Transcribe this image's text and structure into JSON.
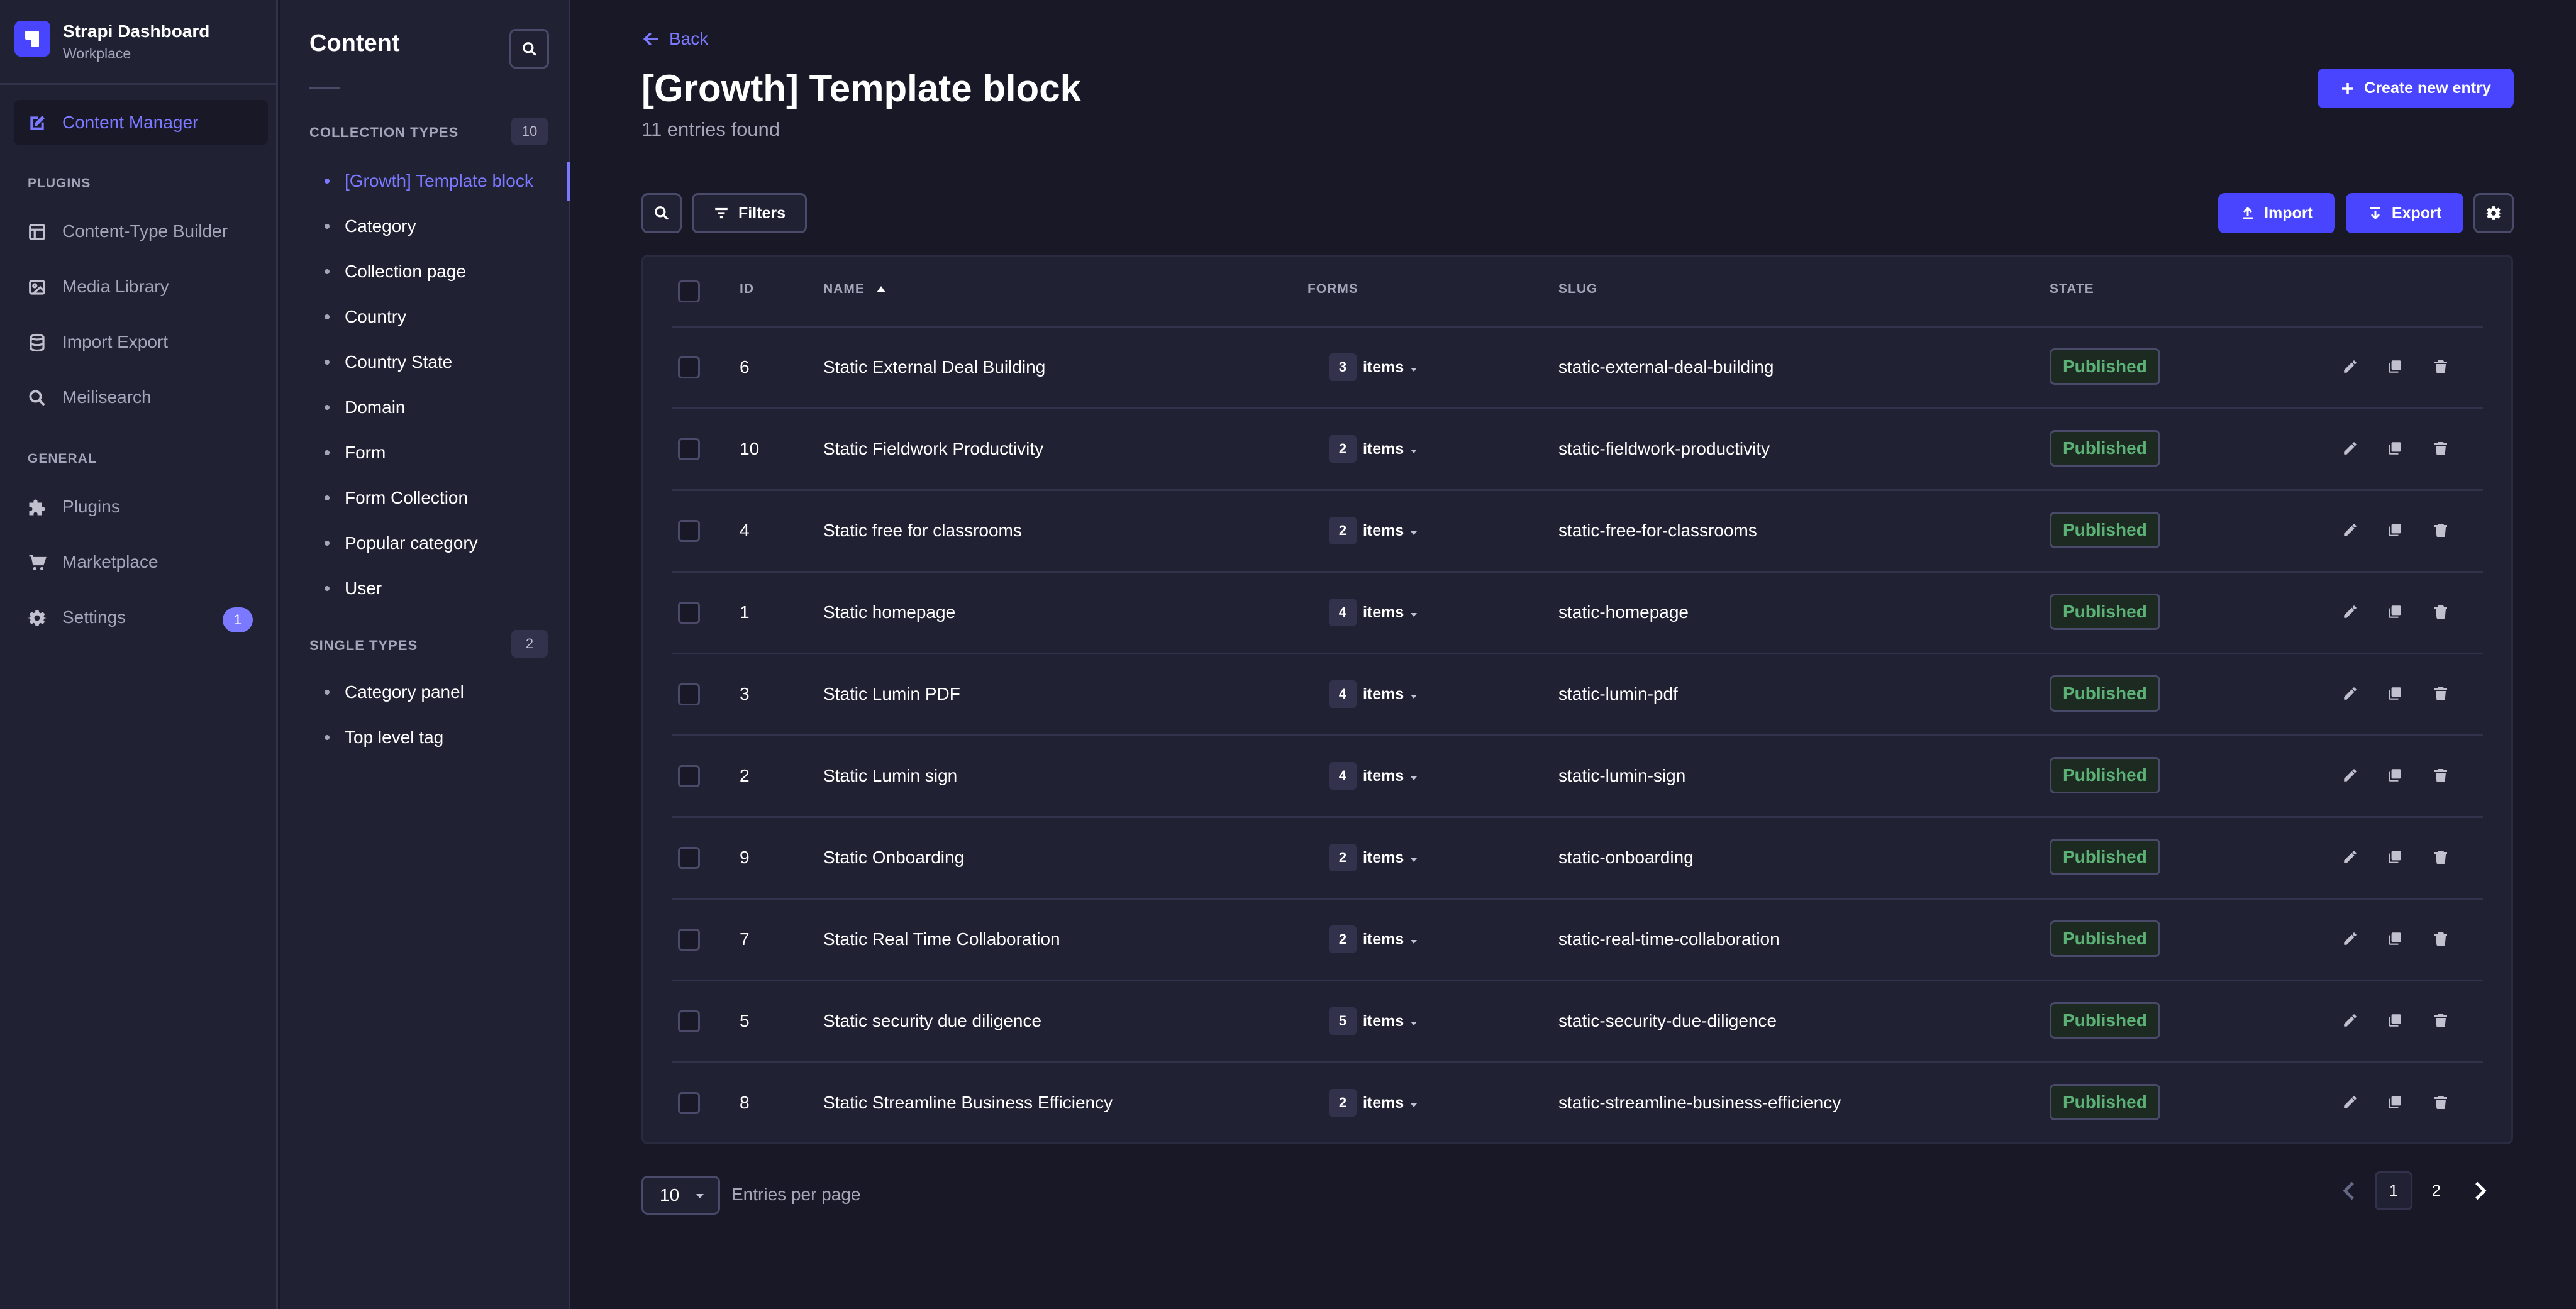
{
  "brand": {
    "title": "Strapi Dashboard",
    "subtitle": "Workplace"
  },
  "mainnav": {
    "content_manager": "Content Manager",
    "plugins_heading": "PLUGINS",
    "plugins": [
      "Content-Type Builder",
      "Media Library",
      "Import Export",
      "Meilisearch"
    ],
    "general_heading": "GENERAL",
    "general": [
      "Plugins",
      "Marketplace",
      "Settings"
    ],
    "settings_badge": "1"
  },
  "subnav": {
    "title": "Content",
    "collection_heading": "COLLECTION TYPES",
    "collection_count": "10",
    "collection_items": [
      "[Growth] Template block",
      "Category",
      "Collection page",
      "Country",
      "Country State",
      "Domain",
      "Form",
      "Form Collection",
      "Popular category",
      "User"
    ],
    "single_heading": "SINGLE TYPES",
    "single_count": "2",
    "single_items": [
      "Category panel",
      "Top level tag"
    ]
  },
  "header": {
    "back_label": "Back",
    "title": "[Growth] Template block",
    "subtitle": "11 entries found",
    "create_label": "Create new entry"
  },
  "toolbar": {
    "filters_label": "Filters",
    "import_label": "Import",
    "export_label": "Export"
  },
  "table": {
    "columns": {
      "id": "ID",
      "name": "NAME",
      "forms": "FORMS",
      "slug": "SLUG",
      "state": "STATE"
    },
    "items_label": "items",
    "rows": [
      {
        "id": "6",
        "name": "Static External Deal Building",
        "forms": "3",
        "slug": "static-external-deal-building",
        "state": "Published"
      },
      {
        "id": "10",
        "name": "Static Fieldwork Productivity",
        "forms": "2",
        "slug": "static-fieldwork-productivity",
        "state": "Published"
      },
      {
        "id": "4",
        "name": "Static free for classrooms",
        "forms": "2",
        "slug": "static-free-for-classrooms",
        "state": "Published"
      },
      {
        "id": "1",
        "name": "Static homepage",
        "forms": "4",
        "slug": "static-homepage",
        "state": "Published"
      },
      {
        "id": "3",
        "name": "Static Lumin PDF",
        "forms": "4",
        "slug": "static-lumin-pdf",
        "state": "Published"
      },
      {
        "id": "2",
        "name": "Static Lumin sign",
        "forms": "4",
        "slug": "static-lumin-sign",
        "state": "Published"
      },
      {
        "id": "9",
        "name": "Static Onboarding",
        "forms": "2",
        "slug": "static-onboarding",
        "state": "Published"
      },
      {
        "id": "7",
        "name": "Static Real Time Collaboration",
        "forms": "2",
        "slug": "static-real-time-collaboration",
        "state": "Published"
      },
      {
        "id": "5",
        "name": "Static security due diligence",
        "forms": "5",
        "slug": "static-security-due-diligence",
        "state": "Published"
      },
      {
        "id": "8",
        "name": "Static Streamline Business Efficiency",
        "forms": "2",
        "slug": "static-streamline-business-efficiency",
        "state": "Published"
      }
    ]
  },
  "pagination": {
    "per_page": "10",
    "per_page_label": "Entries per page",
    "pages": [
      "1",
      "2"
    ],
    "current": "1"
  },
  "colors": {
    "accent": "#7b79ff",
    "primary": "#4945ff",
    "success": "#5cb176"
  }
}
